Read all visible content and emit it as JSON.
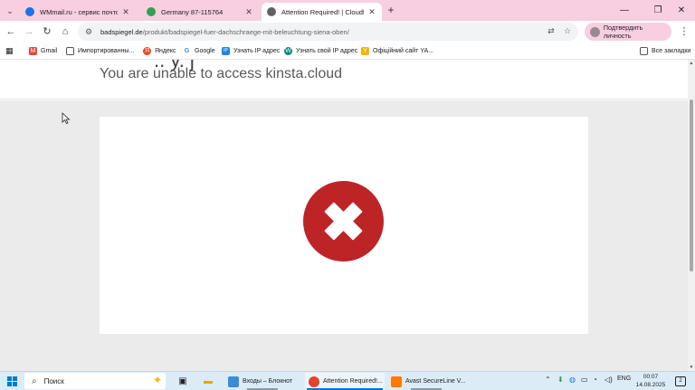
{
  "tabs": [
    {
      "label": "WMmail.ru - сервис почтовых",
      "favicon_color": "#1a73e8",
      "active": false
    },
    {
      "label": "Germany 87-115764",
      "favicon_color": "#30a14e",
      "active": false
    },
    {
      "label": "Attention Required! | Cloudflare",
      "favicon_color": "#5f6368",
      "active": true
    }
  ],
  "tab_close_glyph": "✕",
  "new_tab_glyph": "+",
  "window_controls": {
    "minimize": "—",
    "maximize": "❐",
    "close": "✕"
  },
  "address_bar": {
    "domain": "badspiegel.de",
    "path": "/produkt/badspiegel-fuer-dachschraege-mit-beleuchtung-siena-oben/"
  },
  "profile_button": {
    "label": "Подтвердить личность"
  },
  "bookmarks": [
    {
      "label": "Gmail",
      "icon": "gmail-icon",
      "color": "#ea4335"
    },
    {
      "label": "Импортированны...",
      "icon": "folder-icon",
      "color": "#555555"
    },
    {
      "label": "Яндекс",
      "icon": "yandex-icon",
      "color": "#fc3f1d"
    },
    {
      "label": "Google",
      "icon": "google-icon",
      "color": "#4285f4"
    },
    {
      "label": "Узнать IP адрес",
      "icon": "ip-icon",
      "color": "#1e88e5"
    },
    {
      "label": "Узнать свой IP адрес",
      "icon": "w-icon",
      "color": "#00897b"
    },
    {
      "label": "Офіційний сайт YA...",
      "icon": "ya-icon",
      "color": "#f4b400"
    }
  ],
  "all_bookmarks": "Все закладки",
  "page": {
    "subheading": "You are unable to access kinsta.cloud",
    "error_color": "#bd2426"
  },
  "taskbar": {
    "search_label": "Поиск",
    "apps": [
      {
        "label": "Входы – Блокнот",
        "color": "#3a8dd8",
        "active": false
      },
      {
        "label": "Attention Required!...",
        "color": "#e0442a",
        "active": true
      },
      {
        "label": "Avast SecureLine V...",
        "color": "#ff7800",
        "active": false
      }
    ],
    "language": "ENG",
    "time": "00:07",
    "date": "14.08.2025",
    "notification_count": "2"
  }
}
